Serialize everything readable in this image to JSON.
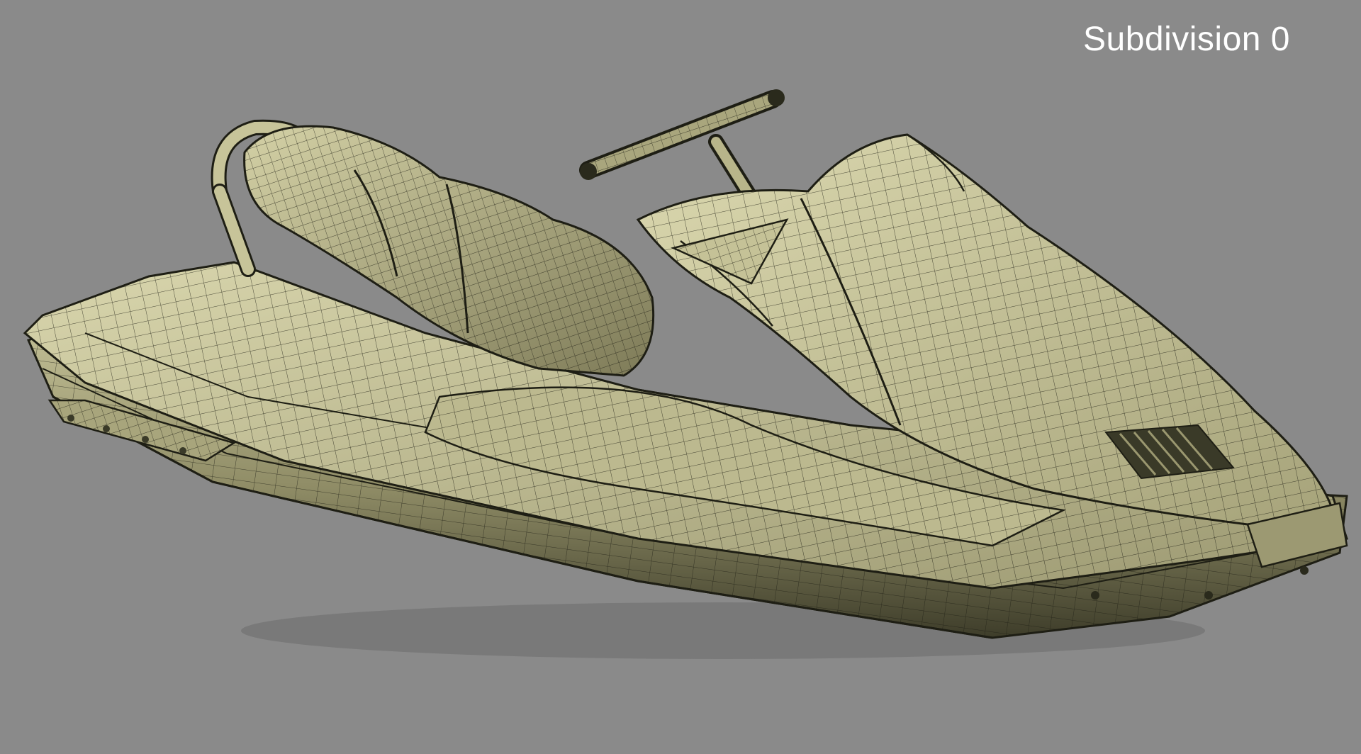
{
  "viewport": {
    "label": "Subdivision 0",
    "background_color": "#8a8a8a"
  },
  "model": {
    "subject": "jet-ski-wireframe",
    "base_color": "#cfcca0",
    "shadow_color": "#4a4a32",
    "wire_color": "#1e1e14"
  }
}
